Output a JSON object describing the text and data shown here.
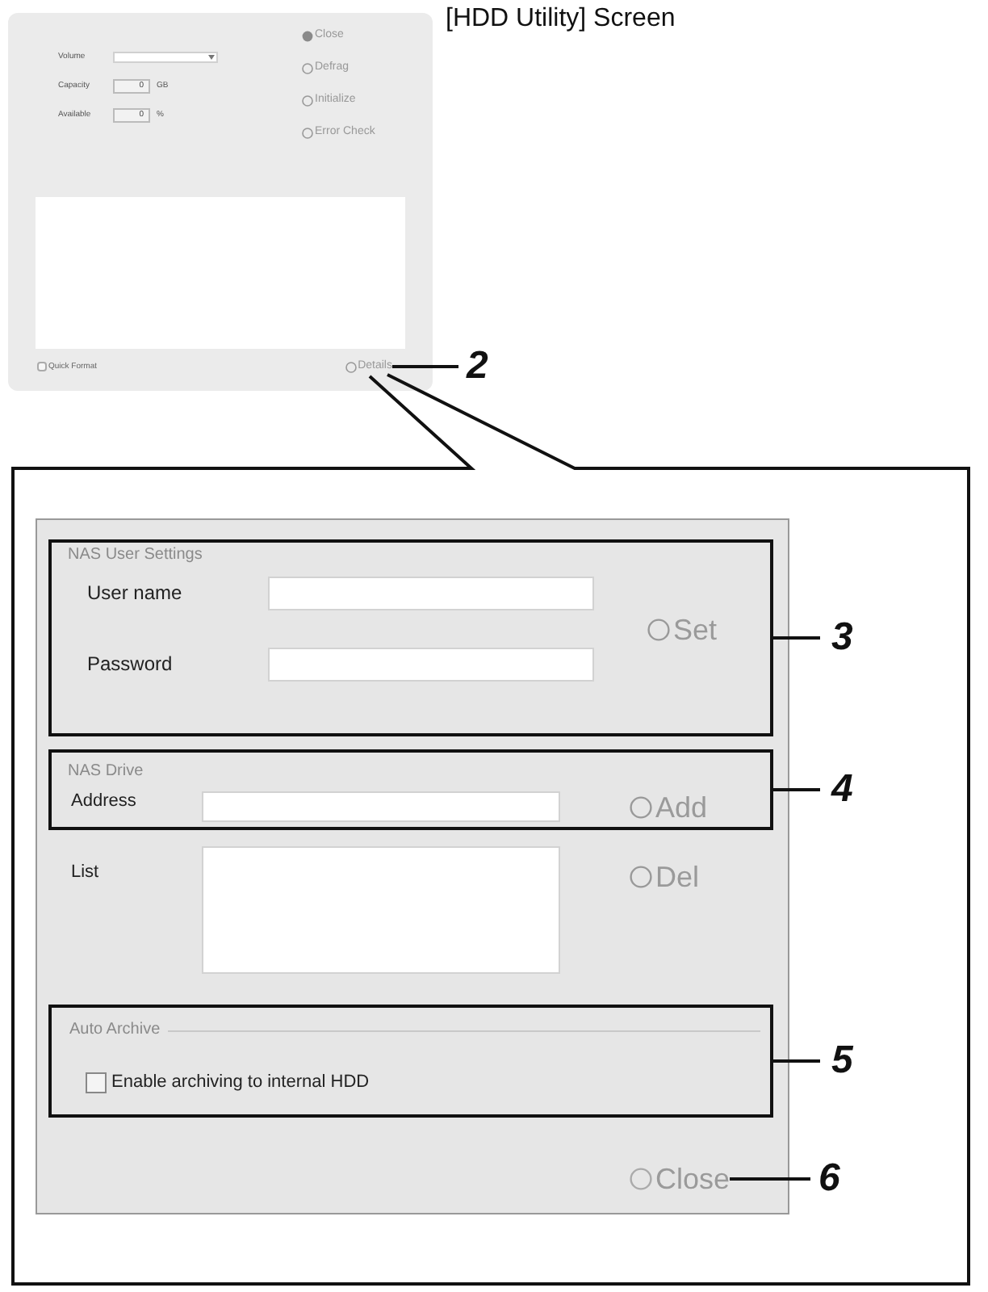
{
  "title": "[HDD Utility] Screen",
  "hdd_utility": {
    "fields": [
      {
        "kind": "dropdown",
        "label": "Volume"
      },
      {
        "kind": "number",
        "label": "Capacity",
        "value": "0",
        "unit": "GB"
      },
      {
        "kind": "number",
        "label": "Available",
        "value": "0",
        "unit": "%"
      }
    ],
    "buttons": [
      {
        "kind": "close",
        "label": "Close"
      },
      {
        "kind": "action",
        "label": "Defrag"
      },
      {
        "kind": "action",
        "label": "Initialize"
      },
      {
        "kind": "action",
        "label": "Error Check"
      }
    ],
    "quick_format": {
      "label": "Quick Format",
      "checked": false
    },
    "details_button": {
      "label": "Details",
      "callout": "2"
    }
  },
  "details_dialog": {
    "nas_user_settings": {
      "legend": "NAS User Settings",
      "fields": [
        {
          "label": "User name"
        },
        {
          "label": "Password"
        }
      ],
      "button": "Set",
      "callout": "3"
    },
    "nas_drive": {
      "legend": "NAS Drive",
      "address_label": "Address",
      "button": "Add",
      "callout": "4"
    },
    "list": {
      "label": "List",
      "button": "Del"
    },
    "auto_archive": {
      "legend": "Auto Archive",
      "checkbox": {
        "label": "Enable archiving to internal HDD",
        "checked": false
      },
      "callout": "5"
    },
    "close_button": {
      "label": "Close",
      "callout": "6"
    }
  }
}
